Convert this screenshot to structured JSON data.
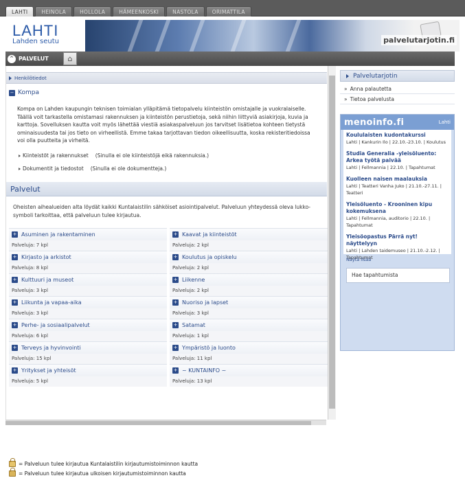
{
  "tabs": [
    "LAHTI",
    "HEINOLA",
    "HOLLOLA",
    "HÄMEENKOSKI",
    "NASTOLA",
    "ORIMATTILA"
  ],
  "logo": {
    "big": "LAHTI",
    "small": "Lahden seutu"
  },
  "brand": "palvelutarjotin.fi",
  "nav": {
    "label": "PALVELUT",
    "home_icon": "home-icon"
  },
  "henkilotiedot": "Henkilötiedot",
  "kompa": {
    "title": "Kompa",
    "text": "Kompa on Lahden kaupungin teknisen toimialan ylläpitämä tietopalvelu kiinteistön omistajalle ja vuokralaiselle. Täällä voit tarkastella omistamasi rakennuksen ja kiinteistön perustietoja, sekä niihin liittyviä asiakirjoja, kuvia ja karttoja. Sovelluksen kautta voit myös lähettää viestiä asiakaspalveluun jos tarvitset lisätietoa kohteen tietystä ominaisuudesta tai jos tieto on virheellistä. Emme takaa tarjottavan tiedon oikeellisuutta, koska rekisteritiedoissa voi olla puutteita ja virheitä.",
    "links": [
      {
        "label": "Kiinteistöt ja rakennukset",
        "note": "(Sinulla ei ole kiinteistöjä eikä rakennuksia.)"
      },
      {
        "label": "Dokumentit ja tiedostot",
        "note": "(Sinulla ei ole dokumentteja.)"
      }
    ]
  },
  "palvelut": {
    "title": "Palvelut",
    "intro": "Oheisten aihealueiden alta löydät kaikki Kuntalaistilin sähköiset asiointipalvelut. Palveluun yhteydessä oleva lukko-symboli tarkoittaa, että palveluun tulee kirjautua.",
    "items": [
      {
        "name": "Asuminen ja rakentaminen",
        "count": "Palveluja: 7 kpl"
      },
      {
        "name": "Kaavat ja kiinteistöt",
        "count": "Palveluja: 2 kpl"
      },
      {
        "name": "Kirjasto ja arkistot",
        "count": "Palveluja: 8 kpl"
      },
      {
        "name": "Koulutus ja opiskelu",
        "count": "Palveluja: 2 kpl"
      },
      {
        "name": "Kulttuuri ja museot",
        "count": "Palveluja: 3 kpl"
      },
      {
        "name": "Liikenne",
        "count": "Palveluja: 2 kpl"
      },
      {
        "name": "Liikunta ja vapaa-aika",
        "count": "Palveluja: 3 kpl"
      },
      {
        "name": "Nuoriso ja lapset",
        "count": "Palveluja: 3 kpl"
      },
      {
        "name": "Perhe- ja sosiaalipalvelut",
        "count": "Palveluja: 6 kpl"
      },
      {
        "name": "Satamat",
        "count": "Palveluja: 1 kpl"
      },
      {
        "name": "Terveys ja hyvinvointi",
        "count": "Palveluja: 15 kpl"
      },
      {
        "name": "Ympäristö ja luonto",
        "count": "Palveluja: 11 kpl"
      },
      {
        "name": "Yritykset ja yhteisöt",
        "count": "Palveluja: 5 kpl"
      },
      {
        "name": "~ KUNTAINFO ~",
        "count": "Palveluja: 13 kpl"
      }
    ],
    "legend": [
      "= Palveluun tulee kirjautua Kuntalaistilin kirjautumistoiminnon kautta",
      "= Palveluun tulee kirjautua ulkoisen kirjautumistoiminnon kautta"
    ]
  },
  "sidebar": {
    "title": "Palvelutarjotin",
    "items": [
      "Anna palautetta",
      "Tietoa palvelusta"
    ],
    "menoinfo": {
      "logo": "menoinfo.fi",
      "city": "Lahti",
      "events": [
        {
          "title": "Koululaisten kudontakurssi",
          "meta": "Lahti | Kankurin Ilo | 22.10.-23.10. | Koulutus"
        },
        {
          "title": "Studia Generalia -yleisöluento: Arkea työtä paivää",
          "meta": "Lahti | Fellmannia | 22.10. | Tapahtumat"
        },
        {
          "title": "Kuolleen naisen maalauksia",
          "meta": "Lahti | Teatteri Vanha Juko | 21.10.-27.11. | Teatteri"
        },
        {
          "title": "Yleisöluento - Krooninen kipu kokemuksena",
          "meta": "Lahti | Fellmannia, auditorio | 22.10. | Tapahtumat"
        },
        {
          "title": "Yleisöopastus Pärrä nyt! näyttelyyn",
          "meta": "Lahti | Lahden taidemuseo | 21.10.-2.12. | Tapahtumat"
        }
      ],
      "more": "Näytä lisää",
      "search": "Hae tapahtumista"
    }
  }
}
